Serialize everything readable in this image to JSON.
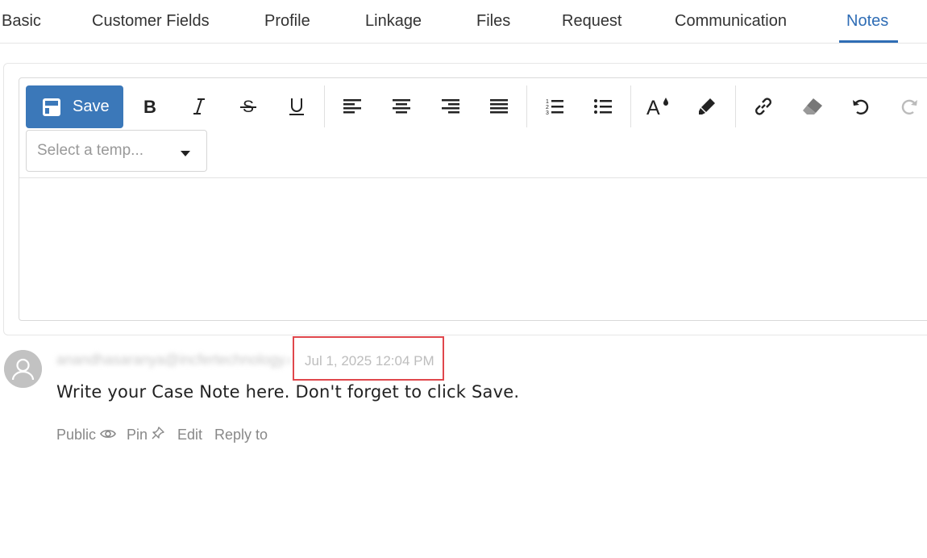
{
  "tabs": [
    {
      "label": "Basic",
      "active": false
    },
    {
      "label": "Customer Fields",
      "active": false
    },
    {
      "label": "Profile",
      "active": false
    },
    {
      "label": "Linkage",
      "active": false
    },
    {
      "label": "Files",
      "active": false
    },
    {
      "label": "Request",
      "active": false
    },
    {
      "label": "Communication",
      "active": false
    },
    {
      "label": "Notes",
      "active": true
    }
  ],
  "toolbar": {
    "save_label": "Save",
    "template_placeholder": "Select a temp...",
    "buttons": [
      "bold-icon",
      "italic-icon",
      "strikethrough-icon",
      "underline-icon",
      "align-left-icon",
      "align-center-icon",
      "align-right-icon",
      "align-justify-icon",
      "ordered-list-icon",
      "unordered-list-icon",
      "font-color-icon",
      "highlight-icon",
      "link-icon",
      "eraser-icon",
      "undo-icon",
      "redo-icon"
    ]
  },
  "note": {
    "author": "anandhasaranya@incfertechnology.com",
    "timestamp": "Jul 1, 2025 12:04 PM",
    "text": "Write your Case Note here. Don't forget to click Save.",
    "actions": {
      "public": "Public",
      "pin": "Pin",
      "edit": "Edit",
      "reply": "Reply to"
    }
  },
  "colors": {
    "accent": "#2f6db5",
    "save_button": "#3b78b9",
    "highlight_box": "#e0474c"
  }
}
